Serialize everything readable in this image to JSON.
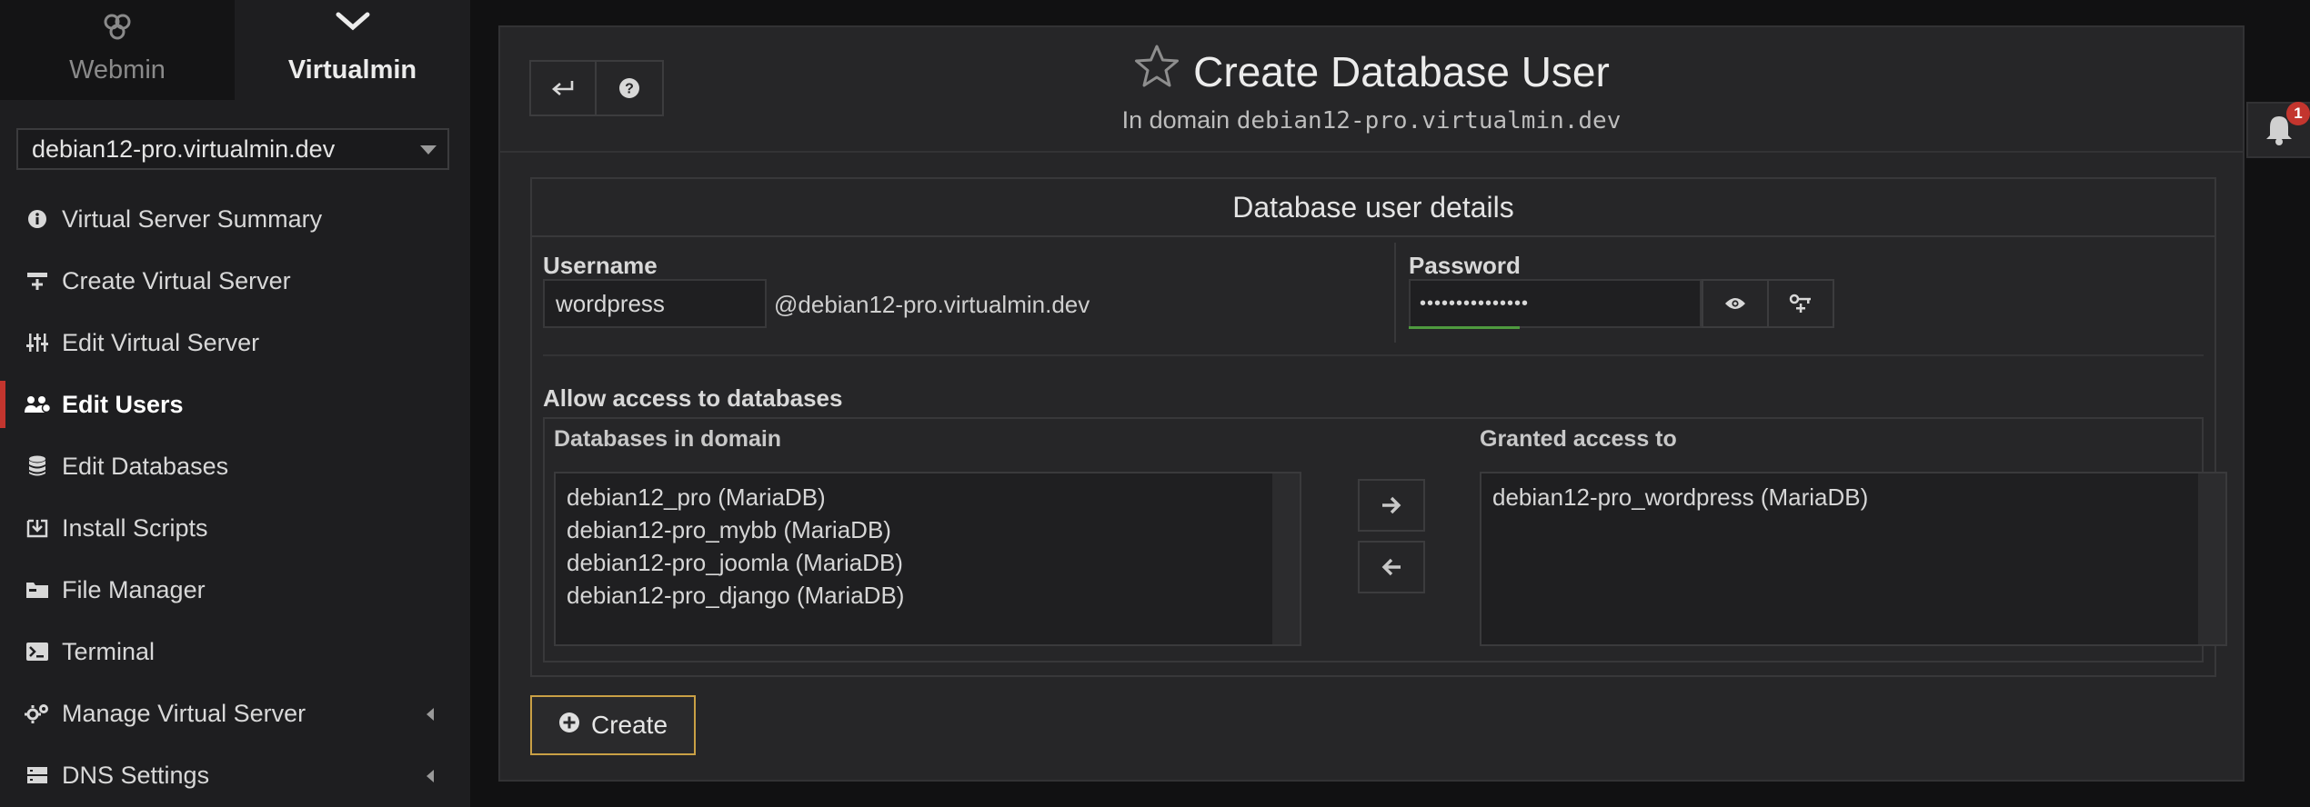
{
  "sidebar": {
    "switch": {
      "webmin_label": "Webmin",
      "virtualmin_label": "Virtualmin"
    },
    "domain_select": {
      "value": "debian12-pro.virtualmin.dev"
    },
    "items": [
      {
        "label": "Virtual Server Summary",
        "icon": "info-circle-icon"
      },
      {
        "label": "Create Virtual Server",
        "icon": "plus-server-icon"
      },
      {
        "label": "Edit Virtual Server",
        "icon": "sliders-icon"
      },
      {
        "label": "Edit Users",
        "icon": "users-icon",
        "active": true
      },
      {
        "label": "Edit Databases",
        "icon": "database-icon"
      },
      {
        "label": "Install Scripts",
        "icon": "download-box-icon"
      },
      {
        "label": "File Manager",
        "icon": "folder-icon"
      },
      {
        "label": "Terminal",
        "icon": "terminal-icon"
      },
      {
        "label": "Manage Virtual Server",
        "icon": "gears-icon",
        "has_submenu": true
      },
      {
        "label": "DNS Settings",
        "icon": "dns-server-icon",
        "has_submenu": true
      }
    ]
  },
  "header": {
    "title": "Create Database User",
    "subtitle_prefix": "In domain",
    "subtitle_domain": "debian12-pro.virtualmin.dev"
  },
  "form": {
    "section_title": "Database user details",
    "username_label": "Username",
    "username_value": "wordpress",
    "at_domain": "@debian12-pro.virtualmin.dev",
    "password_label": "Password",
    "password_value": "•••••••••••••••",
    "password_strength": 0.38,
    "allow_access_label": "Allow access to databases",
    "databases_in_domain_label": "Databases in domain",
    "granted_access_label": "Granted access to",
    "databases_in_domain": [
      "debian12_pro (MariaDB)",
      "debian12-pro_mybb (MariaDB)",
      "debian12-pro_joomla (MariaDB)",
      "debian12-pro_django (MariaDB)"
    ],
    "granted_access": [
      "debian12-pro_wordpress (MariaDB)"
    ],
    "create_label": "Create"
  },
  "notifications": {
    "count": "1"
  },
  "colors": {
    "accent_active": "#c3352e",
    "create_border": "#c9a045",
    "strength_bar": "#4f9a3f"
  }
}
